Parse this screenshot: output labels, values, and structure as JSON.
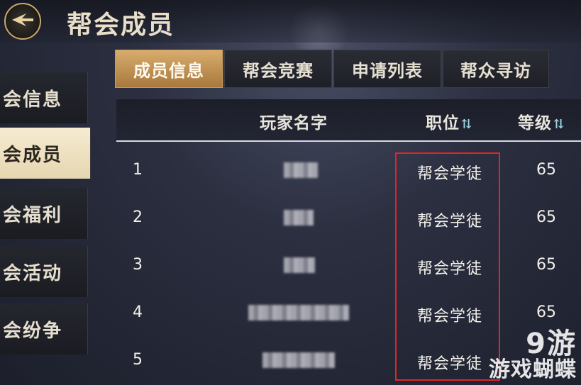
{
  "header": {
    "title": "帮会成员",
    "back_icon": "back-arrow-icon"
  },
  "sidebar": {
    "items": [
      {
        "label": "会信息",
        "active": false
      },
      {
        "label": "会成员",
        "active": true
      },
      {
        "label": "会福利",
        "active": false
      },
      {
        "label": "会活动",
        "active": false
      },
      {
        "label": "会纷争",
        "active": false
      }
    ]
  },
  "tabs": [
    {
      "label": "成员信息",
      "active": true
    },
    {
      "label": "帮会竞赛",
      "active": false
    },
    {
      "label": "申请列表",
      "active": false
    },
    {
      "label": "帮众寻访",
      "active": false
    }
  ],
  "table": {
    "columns": {
      "name": "玩家名字",
      "position": "职位",
      "level": "等级"
    },
    "rows": [
      {
        "rank": "1",
        "position": "帮会学徒",
        "level": "65"
      },
      {
        "rank": "2",
        "position": "帮会学徒",
        "level": "65"
      },
      {
        "rank": "3",
        "position": "帮会学徒",
        "level": "65"
      },
      {
        "rank": "4",
        "position": "帮会学徒",
        "level": "65"
      },
      {
        "rank": "5",
        "position": "帮会学徒",
        "level": ""
      }
    ]
  },
  "watermark": {
    "logo": "9游",
    "sub": "游戏蝴蝶"
  },
  "colors": {
    "accent": "#c9a86a",
    "active_tab": "#d7ad6d",
    "highlight": "#e0242a"
  }
}
